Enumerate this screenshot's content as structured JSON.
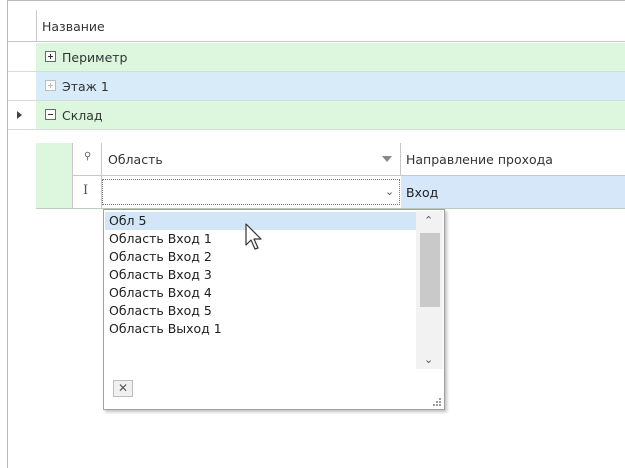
{
  "grid": {
    "header": {
      "title": "Название"
    },
    "rows": [
      {
        "label": "Периметр"
      },
      {
        "label": "Этаж 1"
      },
      {
        "label": "Склад"
      }
    ]
  },
  "detail": {
    "columns": {
      "area": "Область",
      "direction": "Направление прохода"
    },
    "edit_row": {
      "area_value": "",
      "direction_value": "Вход"
    }
  },
  "dropdown": {
    "items": [
      "Обл 5",
      "Область Вход 1",
      "Область Вход 2",
      "Область Вход 3",
      "Область Вход 4",
      "Область Вход 5",
      "Область Выход 1"
    ],
    "selected_index": 0
  },
  "colors": {
    "row_green": "#dcf7de",
    "row_blue": "#d7ebf8",
    "selection": "#d2e6f7"
  },
  "icons": [
    "expand-icon",
    "collapse-icon",
    "search-icon",
    "sort-arrow-icon",
    "dropdown-chevron-icon",
    "clear-icon",
    "mouse-cursor-icon"
  ]
}
